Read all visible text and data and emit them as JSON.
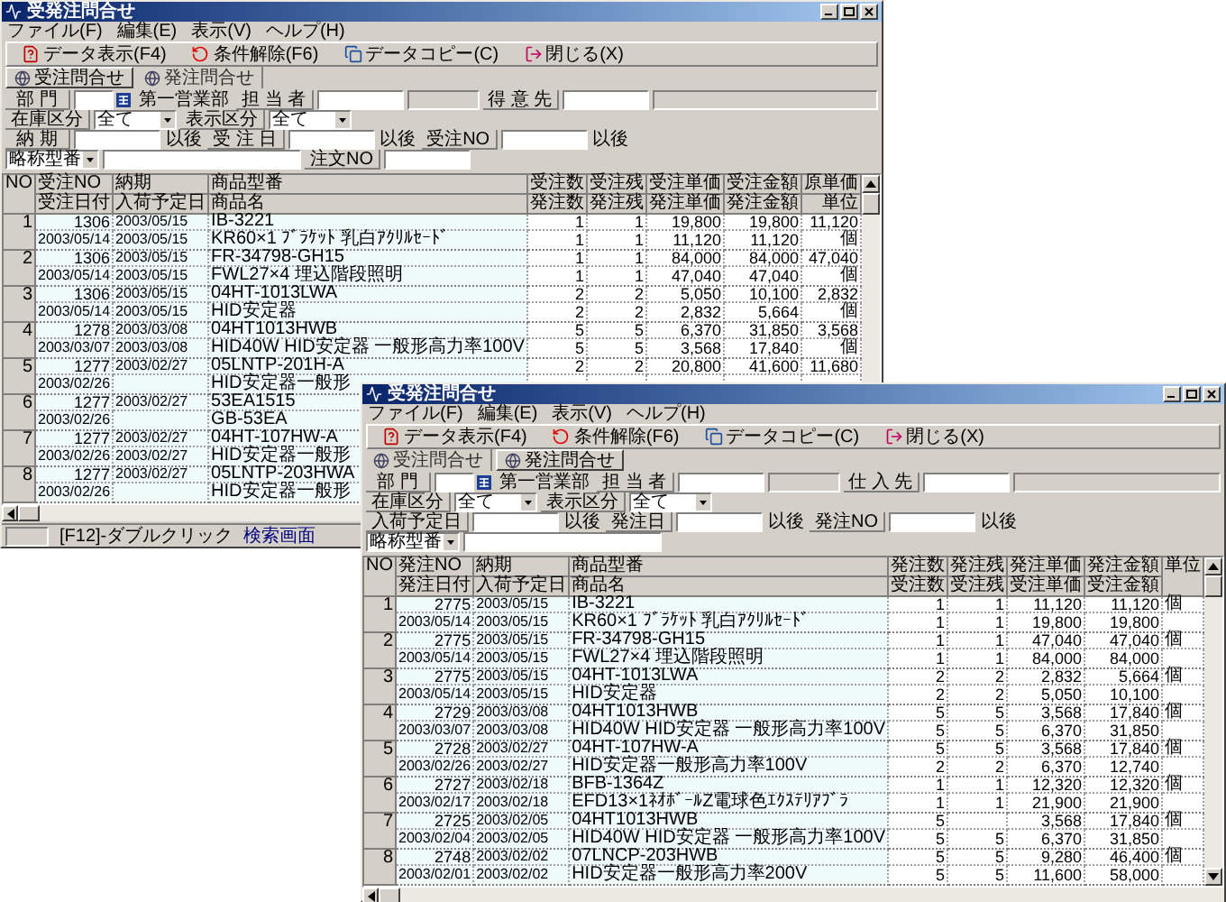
{
  "windows": [
    {
      "title": "受発注問合せ",
      "menu": [
        "ファイル(F)",
        "編集(E)",
        "表示(V)",
        "ヘルプ(H)"
      ],
      "toolbar": [
        {
          "label": "データ表示(F4)",
          "kind": "display"
        },
        {
          "label": "条件解除(F6)",
          "kind": "clear"
        },
        {
          "label": "データコピー(C)",
          "kind": "copy"
        },
        {
          "label": "閉じる(X)",
          "kind": "close"
        }
      ],
      "tabs": [
        {
          "label": "受注問合せ",
          "selected": true
        },
        {
          "label": "発注問合せ",
          "selected": false
        }
      ],
      "form": [
        [
          {
            "kind": "label",
            "text": "部 門"
          },
          {
            "kind": "lookup-input"
          },
          {
            "kind": "text",
            "text": "第一営業部"
          },
          {
            "kind": "label",
            "text": "担 当 者"
          },
          {
            "kind": "input"
          },
          {
            "kind": "display"
          },
          {
            "kind": "label",
            "text": "得 意 先"
          },
          {
            "kind": "input"
          },
          {
            "kind": "fill-display"
          }
        ],
        [
          {
            "kind": "label",
            "text": "在庫区分"
          },
          {
            "kind": "select",
            "value": "全て"
          },
          {
            "kind": "label",
            "text": "表示区分"
          },
          {
            "kind": "select",
            "value": "全て"
          }
        ],
        [
          {
            "kind": "label",
            "text": "納 期"
          },
          {
            "kind": "input"
          },
          {
            "kind": "suffix",
            "text": "以後"
          },
          {
            "kind": "label",
            "text": "受 注 日"
          },
          {
            "kind": "input"
          },
          {
            "kind": "suffix",
            "text": "以後"
          },
          {
            "kind": "label",
            "text": "受注NO"
          },
          {
            "kind": "input"
          },
          {
            "kind": "suffix",
            "text": "以後"
          }
        ],
        [
          {
            "kind": "select",
            "value": "略称型番"
          },
          {
            "kind": "wide-input"
          },
          {
            "kind": "label",
            "text": "注文NO"
          },
          {
            "kind": "input"
          }
        ]
      ],
      "table": {
        "columns": [
          {
            "kind": "no",
            "top": "NO"
          },
          {
            "kind": "code",
            "top": "受注NO",
            "bottom": "受注日付"
          },
          {
            "kind": "date",
            "top": "納期",
            "bottom": "入荷予定日"
          },
          {
            "kind": "product",
            "top": "商品型番",
            "bottom": "商品名"
          },
          {
            "kind": "qty",
            "top": "受注数",
            "bottom": "発注数"
          },
          {
            "kind": "qty",
            "top": "受注残",
            "bottom": "発注残"
          },
          {
            "kind": "money",
            "top": "受注単価",
            "bottom": "発注単価"
          },
          {
            "kind": "money",
            "top": "受注金額",
            "bottom": "発注金額"
          },
          {
            "kind": "qty",
            "top": "原単価",
            "bottom": "単位"
          }
        ],
        "rows": [
          {
            "no": "1",
            "lines": [
              {
                "column_2": "1306",
                "column_3": "2003/05/15",
                "column_4": "IB-3221",
                "column_5": "1",
                "column_6": "1",
                "column_7": "19,800",
                "column_8": "19,800",
                "column_9": "11,120"
              },
              {
                "column_2": "2003/05/14",
                "column_3": "2003/05/15",
                "column_4": "KR60×1 ﾌﾞﾗｹｯﾄ 乳白ｱｸﾘﾙｾｰﾄﾞ",
                "column_5": "1",
                "column_6": "1",
                "column_7": "11,120",
                "column_8": "11,120",
                "column_9": "個"
              }
            ]
          },
          {
            "no": "2",
            "lines": [
              {
                "column_2": "1306",
                "column_3": "2003/05/15",
                "column_4": "FR-34798-GH15",
                "column_5": "1",
                "column_6": "1",
                "column_7": "84,000",
                "column_8": "84,000",
                "column_9": "47,040"
              },
              {
                "column_2": "2003/05/14",
                "column_3": "2003/05/15",
                "column_4": "FWL27×4 埋込階段照明",
                "column_5": "1",
                "column_6": "1",
                "column_7": "47,040",
                "column_8": "47,040",
                "column_9": "個"
              }
            ]
          },
          {
            "no": "3",
            "lines": [
              {
                "column_2": "1306",
                "column_3": "2003/05/15",
                "column_4": "04HT-1013LWA",
                "column_5": "2",
                "column_6": "2",
                "column_7": "5,050",
                "column_8": "10,100",
                "column_9": "2,832"
              },
              {
                "column_2": "2003/05/14",
                "column_3": "2003/05/15",
                "column_4": "HID安定器",
                "column_5": "2",
                "column_6": "2",
                "column_7": "2,832",
                "column_8": "5,664",
                "column_9": "個"
              }
            ]
          },
          {
            "no": "4",
            "lines": [
              {
                "column_2": "1278",
                "column_3": "2003/03/08",
                "column_4": "04HT1013HWB",
                "column_5": "5",
                "column_6": "5",
                "column_7": "6,370",
                "column_8": "31,850",
                "column_9": "3,568"
              },
              {
                "column_2": "2003/03/07",
                "column_3": "2003/03/08",
                "column_4": "HID40W HID安定器 一般形高力率100V",
                "column_5": "5",
                "column_6": "5",
                "column_7": "3,568",
                "column_8": "17,840",
                "column_9": "個"
              }
            ]
          },
          {
            "no": "5",
            "lines": [
              {
                "column_2": "1277",
                "column_3": "2003/02/27",
                "column_4": "05LNTP-201H-A",
                "column_5": "2",
                "column_6": "2",
                "column_7": "20,800",
                "column_8": "41,600",
                "column_9": "11,680"
              },
              {
                "column_2": "2003/02/26",
                "column_4": "HID安定器一般形"
              }
            ]
          },
          {
            "no": "6",
            "lines": [
              {
                "column_2": "1277",
                "column_3": "2003/02/27",
                "column_4": "53EA1515"
              },
              {
                "column_2": "2003/02/26",
                "column_4": "GB-53EA"
              }
            ]
          },
          {
            "no": "7",
            "lines": [
              {
                "column_2": "1277",
                "column_3": "2003/02/27",
                "column_4": "04HT-107HW-A"
              },
              {
                "column_2": "2003/02/26",
                "column_3": "2003/02/27",
                "column_4": "HID安定器一般形"
              }
            ]
          },
          {
            "no": "8",
            "lines": [
              {
                "column_2": "1277",
                "column_3": "2003/02/27",
                "column_4": "05LNTP-203HWA"
              },
              {
                "column_2": "2003/02/26",
                "column_4": "HID安定器一般形"
              }
            ]
          }
        ]
      },
      "status_bar": [
        "[F12]-ダブルクリック",
        "検索画面"
      ]
    },
    {
      "title": "受発注問合せ",
      "menu": [
        "ファイル(F)",
        "編集(E)",
        "表示(V)",
        "ヘルプ(H)"
      ],
      "toolbar": [
        {
          "label": "データ表示(F4)",
          "kind": "display"
        },
        {
          "label": "条件解除(F6)",
          "kind": "clear"
        },
        {
          "label": "データコピー(C)",
          "kind": "copy"
        },
        {
          "label": "閉じる(X)",
          "kind": "close"
        }
      ],
      "tabs": [
        {
          "label": "受注問合せ",
          "selected": false
        },
        {
          "label": "発注問合せ",
          "selected": true
        }
      ],
      "form": [
        [
          {
            "kind": "label",
            "text": "部 門"
          },
          {
            "kind": "lookup-input"
          },
          {
            "kind": "text",
            "text": "第一営業部"
          },
          {
            "kind": "label",
            "text": "担 当 者"
          },
          {
            "kind": "input"
          },
          {
            "kind": "display"
          },
          {
            "kind": "label",
            "text": "仕 入 先"
          },
          {
            "kind": "input"
          },
          {
            "kind": "fill-display"
          }
        ],
        [
          {
            "kind": "label",
            "text": "在庫区分"
          },
          {
            "kind": "select",
            "value": "全て"
          },
          {
            "kind": "label",
            "text": "表示区分"
          },
          {
            "kind": "select",
            "value": "全て"
          }
        ],
        [
          {
            "kind": "label",
            "text": "入荷予定日"
          },
          {
            "kind": "input"
          },
          {
            "kind": "suffix",
            "text": "以後"
          },
          {
            "kind": "label",
            "text": "発注日"
          },
          {
            "kind": "input"
          },
          {
            "kind": "suffix",
            "text": "以後"
          },
          {
            "kind": "label",
            "text": "発注NO"
          },
          {
            "kind": "input"
          },
          {
            "kind": "suffix",
            "text": "以後"
          }
        ],
        [
          {
            "kind": "select",
            "value": "略称型番"
          },
          {
            "kind": "wide-input"
          }
        ]
      ],
      "table": {
        "columns": [
          {
            "kind": "no",
            "top": "NO"
          },
          {
            "kind": "code",
            "top": "発注NO",
            "bottom": "発注日付"
          },
          {
            "kind": "date",
            "top": "納期",
            "bottom": "入荷予定日"
          },
          {
            "kind": "product",
            "top": "商品型番",
            "bottom": "商品名"
          },
          {
            "kind": "qty",
            "top": "発注数",
            "bottom": "受注数"
          },
          {
            "kind": "qty",
            "top": "発注残",
            "bottom": "受注残"
          },
          {
            "kind": "money",
            "top": "発注単価",
            "bottom": "受注単価"
          },
          {
            "kind": "money",
            "top": "発注金額",
            "bottom": "受注金額"
          },
          {
            "kind": "unit",
            "top": "単位"
          }
        ],
        "rows": [
          {
            "no": "1",
            "lines": [
              {
                "column_2": "2775",
                "column_3": "2003/05/15",
                "column_4": "IB-3221",
                "column_5": "1",
                "column_6": "1",
                "column_7": "11,120",
                "column_8": "11,120",
                "column_9": "個"
              },
              {
                "column_2": "2003/05/14",
                "column_3": "2003/05/15",
                "column_4": "KR60×1 ﾌﾞﾗｹｯﾄ 乳白ｱｸﾘﾙｾｰﾄﾞ",
                "column_5": "1",
                "column_6": "1",
                "column_7": "19,800",
                "column_8": "19,800"
              }
            ]
          },
          {
            "no": "2",
            "lines": [
              {
                "column_2": "2775",
                "column_3": "2003/05/15",
                "column_4": "FR-34798-GH15",
                "column_5": "1",
                "column_6": "1",
                "column_7": "47,040",
                "column_8": "47,040",
                "column_9": "個"
              },
              {
                "column_2": "2003/05/14",
                "column_3": "2003/05/15",
                "column_4": "FWL27×4 埋込階段照明",
                "column_5": "1",
                "column_6": "1",
                "column_7": "84,000",
                "column_8": "84,000"
              }
            ]
          },
          {
            "no": "3",
            "lines": [
              {
                "column_2": "2775",
                "column_3": "2003/05/15",
                "column_4": "04HT-1013LWA",
                "column_5": "2",
                "column_6": "2",
                "column_7": "2,832",
                "column_8": "5,664",
                "column_9": "個"
              },
              {
                "column_2": "2003/05/14",
                "column_3": "2003/05/15",
                "column_4": "HID安定器",
                "column_5": "2",
                "column_6": "2",
                "column_7": "5,050",
                "column_8": "10,100"
              }
            ]
          },
          {
            "no": "4",
            "lines": [
              {
                "column_2": "2729",
                "column_3": "2003/03/08",
                "column_4": "04HT1013HWB",
                "column_5": "5",
                "column_6": "5",
                "column_7": "3,568",
                "column_8": "17,840",
                "column_9": "個"
              },
              {
                "column_2": "2003/03/07",
                "column_3": "2003/03/08",
                "column_4": "HID40W HID安定器 一般形高力率100V",
                "column_5": "5",
                "column_6": "5",
                "column_7": "6,370",
                "column_8": "31,850"
              }
            ]
          },
          {
            "no": "5",
            "lines": [
              {
                "column_2": "2728",
                "column_3": "2003/02/27",
                "column_4": "04HT-107HW-A",
                "column_5": "5",
                "column_6": "5",
                "column_7": "3,568",
                "column_8": "17,840",
                "column_9": "個"
              },
              {
                "column_2": "2003/02/26",
                "column_3": "2003/02/27",
                "column_4": "HID安定器一般形高力率100V",
                "column_5": "2",
                "column_6": "2",
                "column_7": "6,370",
                "column_8": "12,740"
              }
            ]
          },
          {
            "no": "6",
            "lines": [
              {
                "column_2": "2727",
                "column_3": "2003/02/18",
                "column_4": "BFB-1364Z",
                "column_5": "1",
                "column_6": "1",
                "column_7": "12,320",
                "column_8": "12,320",
                "column_9": "個"
              },
              {
                "column_2": "2003/02/17",
                "column_3": "2003/02/18",
                "column_4": "EFD13×1ﾈｵﾎﾞｰﾙZ電球色ｴｸｽﾃﾘｱﾌﾞﾗ",
                "column_5": "1",
                "column_6": "1",
                "column_7": "21,900",
                "column_8": "21,900"
              }
            ]
          },
          {
            "no": "7",
            "lines": [
              {
                "column_2": "2725",
                "column_3": "2003/02/05",
                "column_4": "04HT1013HWB",
                "column_5": "5",
                "column_7": "3,568",
                "column_8": "17,840",
                "column_9": "個"
              },
              {
                "column_2": "2003/02/04",
                "column_3": "2003/02/05",
                "column_4": "HID40W HID安定器 一般形高力率100V",
                "column_5": "5",
                "column_6": "5",
                "column_7": "6,370",
                "column_8": "31,850"
              }
            ]
          },
          {
            "no": "8",
            "lines": [
              {
                "column_2": "2748",
                "column_3": "2003/02/02",
                "column_4": "07LNCP-203HWB",
                "column_5": "5",
                "column_6": "5",
                "column_7": "9,280",
                "column_8": "46,400",
                "column_9": "個"
              },
              {
                "column_2": "2003/02/01",
                "column_3": "2003/02/02",
                "column_4": "HID安定器一般形高力率200V",
                "column_5": "5",
                "column_6": "5",
                "column_7": "11,600",
                "column_8": "58,000"
              }
            ]
          }
        ]
      }
    }
  ]
}
